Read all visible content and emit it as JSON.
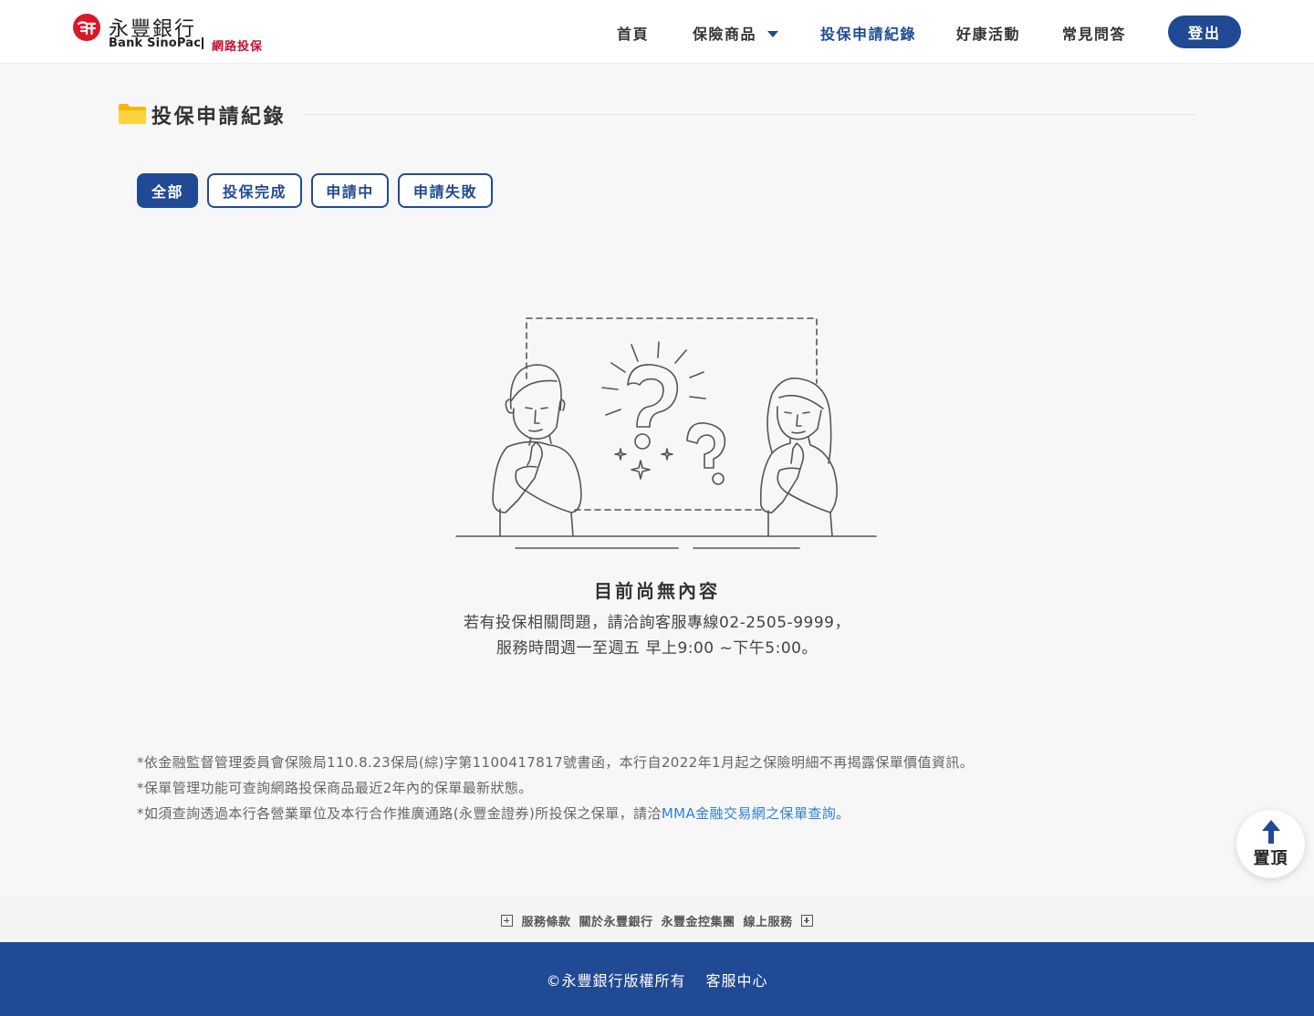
{
  "header": {
    "logo_cn": "永豐銀行",
    "logo_en": "Bank SinoPac",
    "logo_sub": "網路投保",
    "nav": [
      {
        "label": "首頁"
      },
      {
        "label": "保險商品"
      },
      {
        "label": "投保申請紀錄"
      },
      {
        "label": "好康活動"
      },
      {
        "label": "常見問答"
      }
    ],
    "logout": "登出"
  },
  "page": {
    "title": "投保申請紀錄",
    "tabs": [
      {
        "label": "全部"
      },
      {
        "label": "投保完成"
      },
      {
        "label": "申請中"
      },
      {
        "label": "申請失敗"
      }
    ],
    "empty": {
      "title": "目前尚無內容",
      "line1": "若有投保相關問題，請洽詢客服專線02-2505-9999，",
      "line2": "服務時間週一至週五 早上9:00 ~下午5:00。"
    },
    "notes": {
      "note1": "*依金融監督管理委員會保險局110.8.23保局(綜)字第1100417817號書函，本行自2022年1月起之保險明細不再揭露保單價值資訊。",
      "note2": "*保單管理功能可查詢網路投保商品最近2年內的保單最新狀態。",
      "note3_prefix": "*如須查詢透過本行各營業單位及本行合作推廣通路(永豐金證券)所投保之保單，請洽",
      "note3_link": "MMA金融交易網之保單查詢",
      "note3_suffix": "。"
    }
  },
  "back_to_top": "置頂",
  "footer": {
    "links": [
      "服務條款",
      "關於永豐銀行",
      "永豐金控集團",
      "線上服務"
    ],
    "copyright": "©永豐銀行版權所有",
    "service": "客服中心"
  },
  "colors": {
    "primary": "#214a94",
    "brand_red": "#c8102e",
    "link": "#2d7fd8",
    "background": "#f7f7f7"
  }
}
